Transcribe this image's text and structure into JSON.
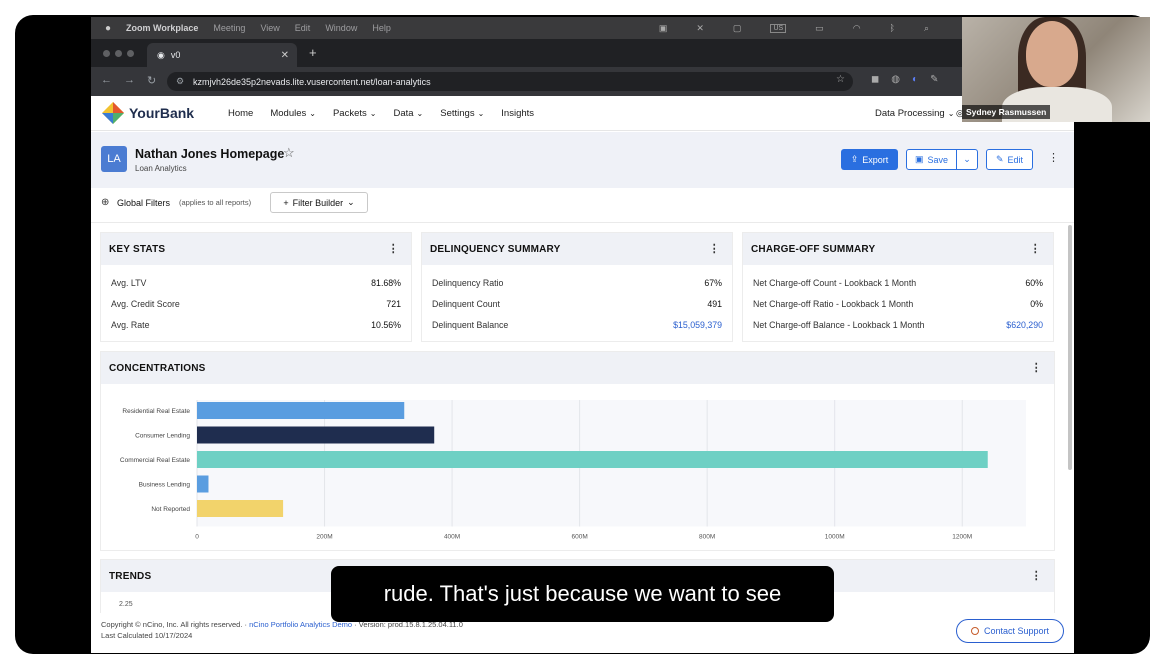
{
  "menubar": {
    "apple": "",
    "app": "Zoom Workplace",
    "items": [
      "Meeting",
      "View",
      "Edit",
      "Window",
      "Help"
    ],
    "input_source": "US"
  },
  "browser": {
    "tab_title": "v0",
    "url": "kzmjvh26de35p2nevads.lite.vusercontent.net/loan-analytics"
  },
  "nav": {
    "brand": "YourBank",
    "items": [
      {
        "label": "Home",
        "chevron": false
      },
      {
        "label": "Modules",
        "chevron": true
      },
      {
        "label": "Packets",
        "chevron": true
      },
      {
        "label": "Data",
        "chevron": true
      },
      {
        "label": "Settings",
        "chevron": true
      },
      {
        "label": "Insights",
        "chevron": false
      }
    ],
    "data_processing": "Data Processing"
  },
  "page": {
    "avatar": "LA",
    "title": "Nathan Jones Homepage",
    "subtitle": "Loan Analytics",
    "export": "Export",
    "save": "Save",
    "edit": "Edit"
  },
  "filters": {
    "label": "Global Filters",
    "note": "(applies to all reports)",
    "builder": "Filter Builder"
  },
  "key_stats": {
    "title": "KEY STATS",
    "rows": [
      {
        "label": "Avg. LTV",
        "value": "81.68%"
      },
      {
        "label": "Avg. Credit Score",
        "value": "721"
      },
      {
        "label": "Avg. Rate",
        "value": "10.56%"
      }
    ]
  },
  "delinquency": {
    "title": "DELINQUENCY SUMMARY",
    "rows": [
      {
        "label": "Delinquency Ratio",
        "value": "67%"
      },
      {
        "label": "Delinquent Count",
        "value": "491"
      },
      {
        "label": "Delinquent Balance",
        "value": "$15,059,379"
      }
    ]
  },
  "chargeoff": {
    "title": "CHARGE-OFF SUMMARY",
    "rows": [
      {
        "label": "Net Charge-off Count - Lookback 1 Month",
        "value": "60%"
      },
      {
        "label": "Net Charge-off Ratio - Lookback 1 Month",
        "value": "0%"
      },
      {
        "label": "Net Charge-off Balance - Lookback 1 Month",
        "value": "$620,290"
      }
    ]
  },
  "concentrations": {
    "title": "CONCENTRATIONS"
  },
  "trends": {
    "title": "TRENDS",
    "partial_tick": "2.25"
  },
  "chart_data": {
    "type": "bar",
    "orientation": "horizontal",
    "categories": [
      "Residential Real Estate",
      "Consumer Lending",
      "Commercial Real Estate",
      "Business Lending",
      "Not Reported"
    ],
    "values": [
      325,
      372,
      1240,
      18,
      135
    ],
    "colors": [
      "#5a9de0",
      "#1f2d4f",
      "#6ed0c4",
      "#5a9de0",
      "#f2d36b"
    ],
    "xticks": [
      "0",
      "200M",
      "400M",
      "600M",
      "800M",
      "1000M",
      "1200M"
    ],
    "xlim": [
      0,
      1300
    ],
    "grid": true
  },
  "footer": {
    "copyright": "Copyright © nCino, Inc. All rights reserved. ·",
    "demo_link": "nCino Portfolio Analytics Demo",
    "version": "· Version: prod.15.8.1.25.04.11.0",
    "last_calc": "Last Calculated 10/17/2024",
    "support": "Contact Support"
  },
  "caption": "rude. That's just because we want to see",
  "participant": "Sydney Rasmussen",
  "accent_color": "#2a6fe0"
}
